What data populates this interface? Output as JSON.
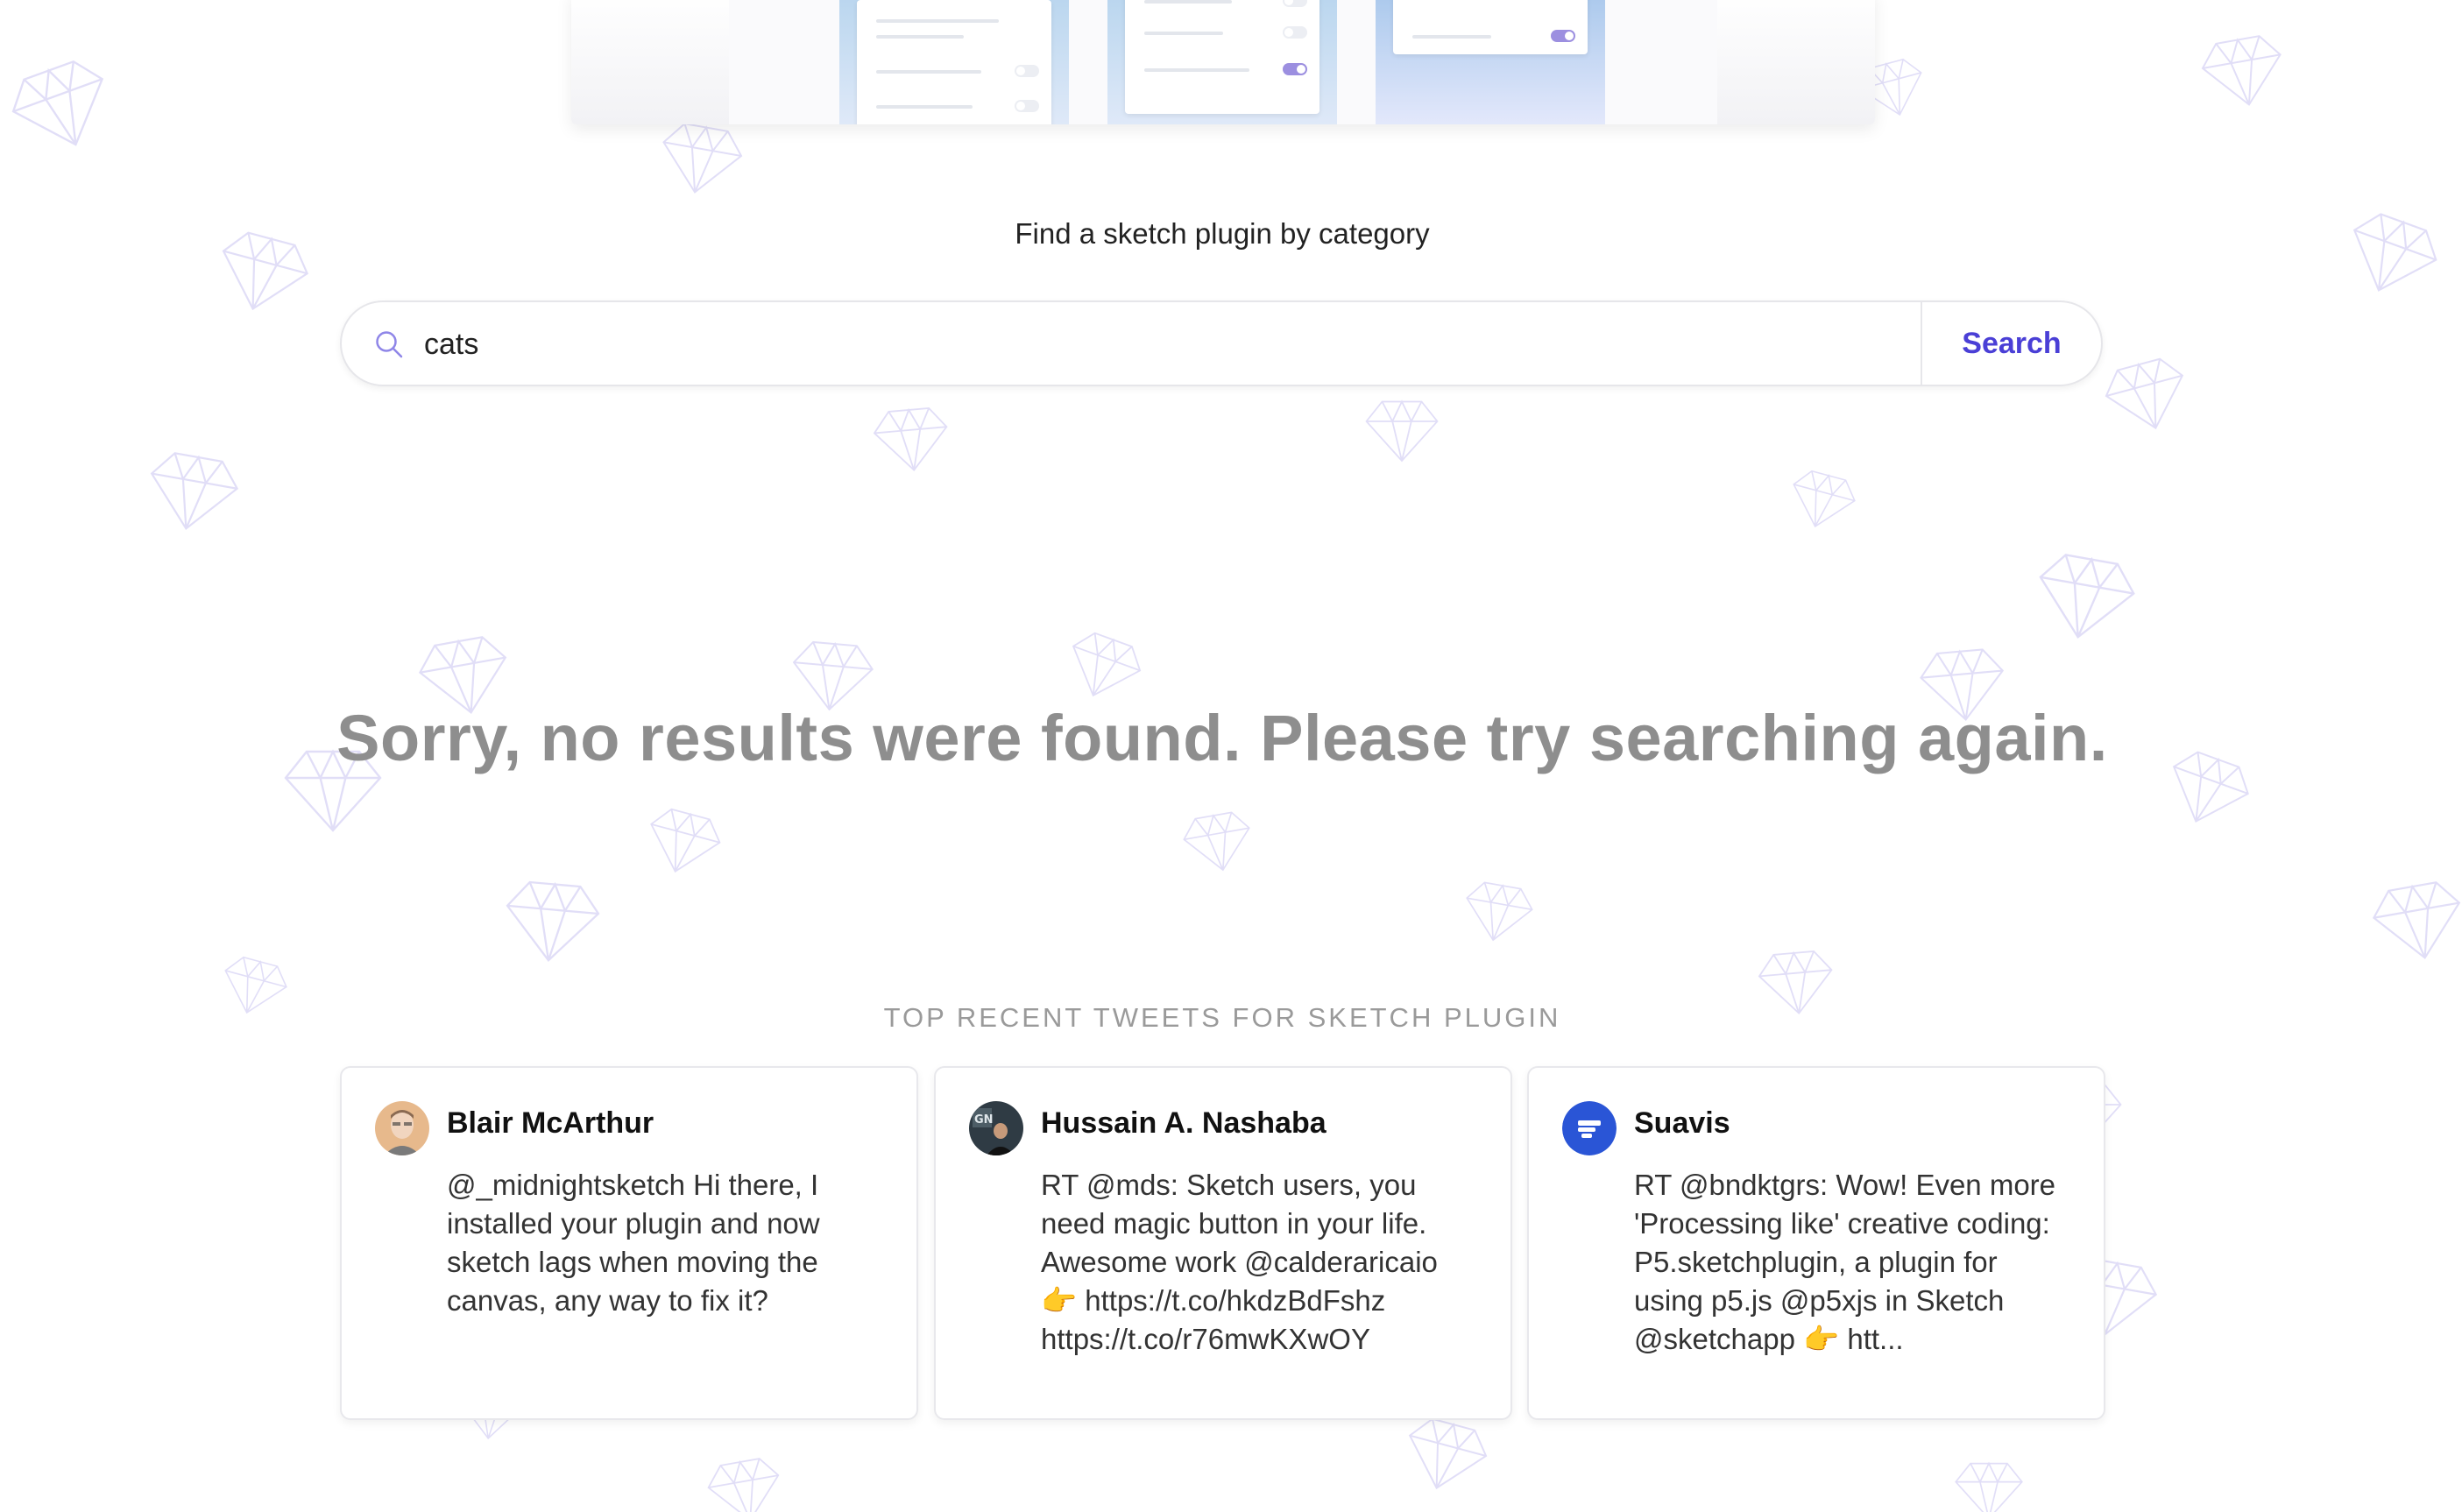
{
  "search": {
    "heading": "Find a sketch plugin by category",
    "query": "cats",
    "button_label": "Search"
  },
  "empty_state": {
    "message": "Sorry, no results were found. Please try searching again."
  },
  "tweets": {
    "heading": "TOP RECENT TWEETS FOR SKETCH PLUGIN",
    "items": [
      {
        "author": "Blair McArthur",
        "text": "@_midnightsketch Hi there, I installed your plugin and now sketch lags when moving the canvas, any way to fix it?"
      },
      {
        "author": "Hussain A. Nashaba",
        "text": "RT @mds: Sketch users, you need magic button in your life. Awesome work @calderaricaio 👉 https://t.co/hkdzBdFshz https://t.co/r76mwKXwOY"
      },
      {
        "author": "Suavis",
        "text": "RT @bndktgrs: Wow! Even more 'Processing like' creative coding: P5.sketchplugin, a plugin for using p5.js @p5xjs in Sketch @sketchapp 👉 htt..."
      }
    ]
  },
  "colors": {
    "accent": "#4a3fd6",
    "pattern": "#c9c4f2",
    "muted_text": "#8e8e8e"
  },
  "icons": {
    "search": "search-icon",
    "background": "diamond-icon"
  }
}
